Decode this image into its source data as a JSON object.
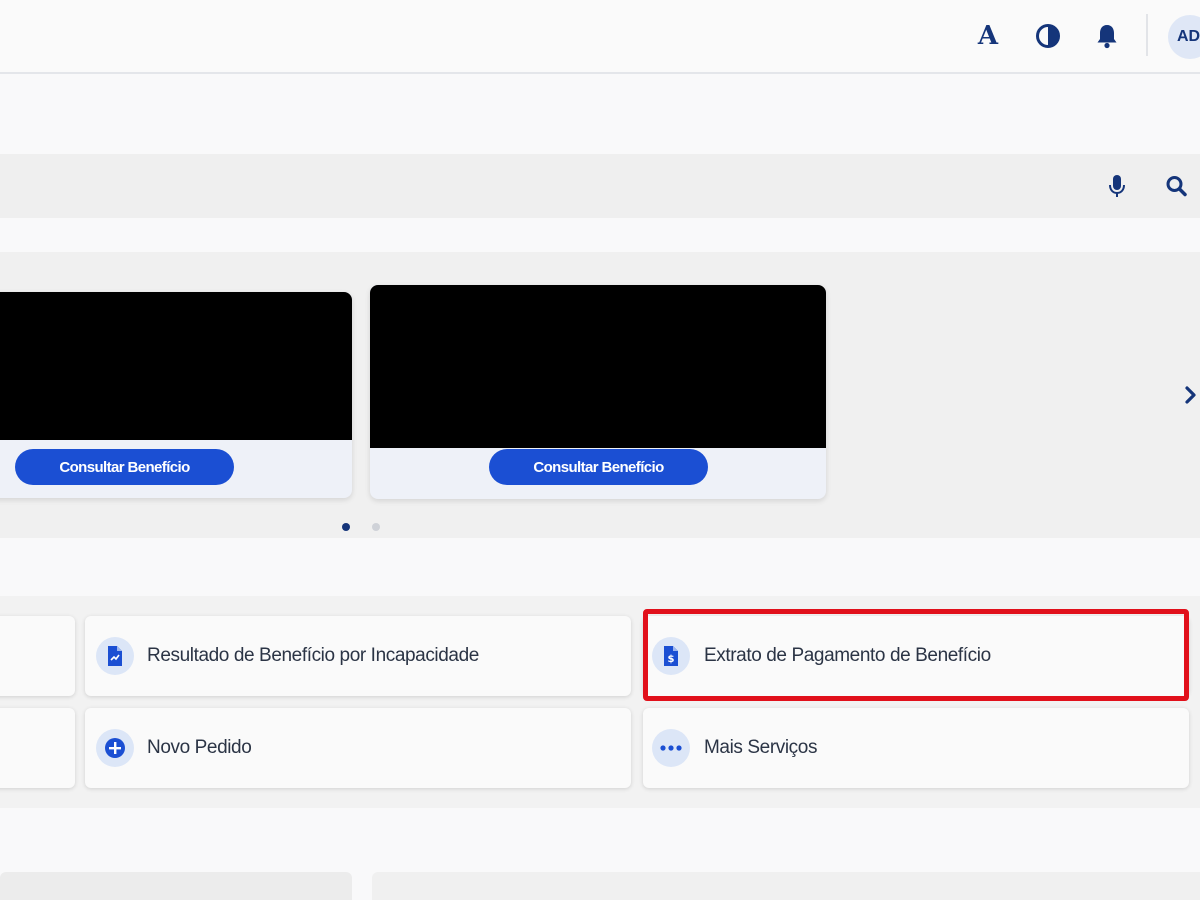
{
  "header": {
    "font_size_button": "A",
    "contrast_icon": "contrast-icon",
    "bell_icon": "bell-icon",
    "avatar_initials": "AD"
  },
  "search": {
    "value": "",
    "placeholder": "",
    "mic_icon": "microphone-icon",
    "search_icon": "search-icon"
  },
  "carousel": {
    "cards": [
      {
        "button_label": "Consultar Benefício"
      },
      {
        "button_label": "Consultar Benefício"
      }
    ],
    "active_page": 1,
    "page_count": 2,
    "next_icon": "chevron-right-icon"
  },
  "services": {
    "items": [
      {
        "label": "Resultado de Benefício por Incapacidade",
        "icon": "document-icon"
      },
      {
        "label": "Extrato de Pagamento de Benefício",
        "icon": "payment-statement-icon"
      },
      {
        "label": "Novo Pedido",
        "icon": "add-circle-icon"
      },
      {
        "label": "Mais Serviços",
        "icon": "more-icon"
      }
    ]
  },
  "bottom": {
    "right_card_text": ""
  },
  "colors": {
    "primary": "#1b4fd3",
    "navy": "#15357a",
    "highlight": "#e1101b"
  }
}
